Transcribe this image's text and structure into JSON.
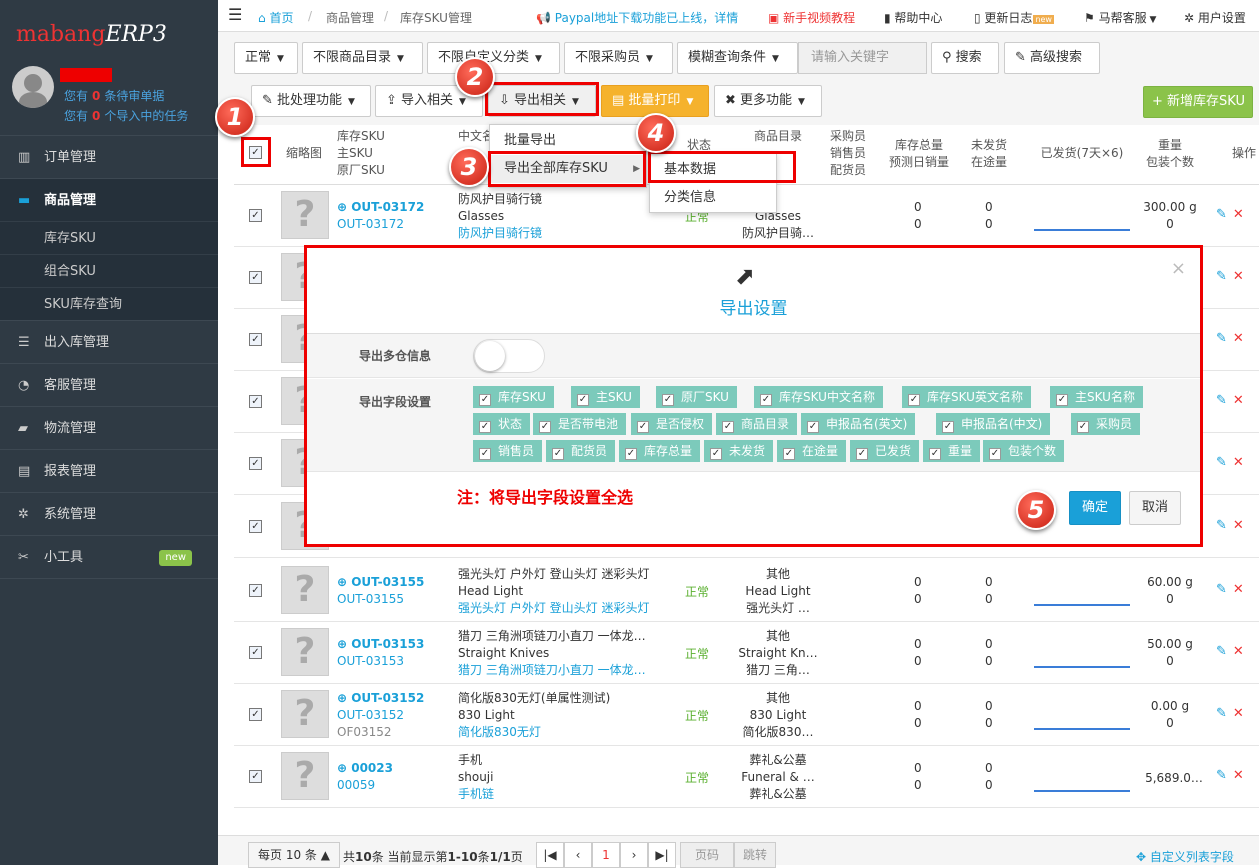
{
  "sidebar": {
    "logo": "mabang",
    "logo_suffix": "ERP3",
    "pending_line_prefix": "您有",
    "pending_count": "0",
    "pending_line_suffix": "条待审单据",
    "import_line_prefix": "您有",
    "import_count": "0",
    "import_line_suffix": "个导入中的任务",
    "menu": [
      {
        "label": "订单管理",
        "icon": "orders-icon"
      },
      {
        "label": "商品管理",
        "icon": "product-icon"
      },
      {
        "label": "出入库管理",
        "icon": "warehouse-icon"
      },
      {
        "label": "客服管理",
        "icon": "chat-icon"
      },
      {
        "label": "物流管理",
        "icon": "truck-icon"
      },
      {
        "label": "报表管理",
        "icon": "report-icon"
      },
      {
        "label": "系统管理",
        "icon": "gear-icon"
      },
      {
        "label": "小工具",
        "icon": "tools-icon",
        "badge": "new"
      }
    ],
    "submenu": [
      "库存SKU",
      "组合SKU",
      "SKU库存查询"
    ]
  },
  "topbar": {
    "home": "首页",
    "crumb1": "商品管理",
    "crumb2": "库存SKU管理",
    "notice": "Paypal地址下载功能已上线，详情",
    "video": "新手视频教程",
    "help": "帮助中心",
    "changelog": "更新日志",
    "changelog_badge": "new",
    "service": "马帮客服",
    "settings": "用户设置"
  },
  "filters": {
    "status": "正常",
    "catalog": "不限商品目录",
    "custom": "不限自定义分类",
    "buyer": "不限采购员",
    "fuzzy": "模糊查询条件",
    "search_placeholder": "请输入关键字",
    "search": "搜索",
    "advanced": "高级搜索"
  },
  "toolbar": {
    "batch": "批处理功能",
    "import": "导入相关",
    "export": "导出相关",
    "print": "批量打印",
    "more": "更多功能",
    "add": "新增库存SKU"
  },
  "table_head": {
    "thumb": "缩略图",
    "sku1": "库存SKU",
    "sku2": "主SKU",
    "sku3": "原厂SKU",
    "name1": "中文名",
    "status": "状态",
    "catalog1": "商品目录",
    "buyer1": "采购员",
    "buyer2": "销售员",
    "buyer3": "配货员",
    "stock1": "库存总量",
    "stock2": "预测日销量",
    "unship1": "未发货",
    "unship2": "在途量",
    "shipped": "已发货(7天×6)",
    "weight1": "重量",
    "weight2": "包装个数",
    "ops": "操作"
  },
  "rows": [
    {
      "sku": "OUT-03172",
      "sku2": "OUT-03172",
      "sku3": "",
      "cn": "防风护目骑行镜",
      "en": "Glasses",
      "cn2": "防风护目骑行镜",
      "status": "正常",
      "cat1": "",
      "cat2": "Glasses",
      "cat3": "防风护目骑…",
      "stock": "0",
      "forecast": "0",
      "unship": "0",
      "transit": "0",
      "weight": "300.00 g",
      "pack": "0",
      "trend": "flat"
    },
    {
      "sku": "OUT-03155",
      "sku2": "OUT-03155",
      "sku3": "",
      "cn": "强光头灯 户外灯 登山头灯 迷彩头灯",
      "en": "Head Light",
      "cn2": "强光头灯 户外灯 登山头灯 迷彩头灯",
      "status": "正常",
      "cat1": "其他",
      "cat2": "Head Light",
      "cat3": "强光头灯 …",
      "stock": "0",
      "forecast": "0",
      "unship": "0",
      "transit": "0",
      "weight": "60.00 g",
      "pack": "0",
      "trend": "flat"
    },
    {
      "sku": "OUT-03153",
      "sku2": "OUT-03153",
      "sku3": "",
      "cn": "猎刀 三角洲项链刀小直刀 一体龙…",
      "en": "Straight Knives",
      "cn2": "猎刀 三角洲项链刀小直刀 一体龙…",
      "status": "正常",
      "cat1": "其他",
      "cat2": "Straight Kn…",
      "cat3": "猎刀 三角…",
      "stock": "0",
      "forecast": "0",
      "unship": "0",
      "transit": "0",
      "weight": "50.00 g",
      "pack": "0",
      "trend": "flat"
    },
    {
      "sku": "OUT-03152",
      "sku2": "OUT-03152",
      "sku3": "OF03152",
      "cn": "简化版830无灯(单属性测试)",
      "en": "830 Light",
      "cn2": "简化版830无灯",
      "status": "正常",
      "cat1": "其他",
      "cat2": "830 Light",
      "cat3": "简化版830…",
      "stock": "0",
      "forecast": "0",
      "unship": "0",
      "transit": "0",
      "weight": "0.00 g",
      "pack": "0",
      "trend": "flat"
    },
    {
      "sku": "00023",
      "sku2": "00059",
      "sku3": "",
      "cn": "手机",
      "en": "shouji",
      "cn2": "手机链",
      "status": "正常",
      "cat1": "葬礼&公墓",
      "cat2": "Funeral & …",
      "cat3": "葬礼&公墓",
      "stock": "0",
      "forecast": "0",
      "unship": "0",
      "transit": "0",
      "weight": "5,689.0…",
      "pack": "0",
      "trend": "flat"
    }
  ],
  "partial_row_text": "…",
  "export_menu": [
    "批量导出",
    "导出全部库存SKU"
  ],
  "export_submenu": [
    "基本数据",
    "分类信息"
  ],
  "modal": {
    "title": "导出设置",
    "close": "×",
    "multi_label": "导出多仓信息",
    "fields_label": "导出字段设置",
    "fields": [
      "库存SKU",
      "主SKU",
      "原厂SKU",
      "库存SKU中文名称",
      "库存SKU英文名称",
      "主SKU名称",
      "状态",
      "是否带电池",
      "是否侵权",
      "商品目录",
      "申报品名(英文)",
      "申报品名(中文)",
      "采购员",
      "销售员",
      "配货员",
      "库存总量",
      "未发货",
      "在途量",
      "已发货",
      "重量",
      "包装个数"
    ],
    "note": "注：将导出字段设置全选",
    "confirm": "确定",
    "cancel": "取消"
  },
  "steps": [
    "1",
    "2",
    "3",
    "4",
    "5"
  ],
  "pager": {
    "per_page": "每页 10 条",
    "summary_a": "共",
    "total": "10",
    "summary_b": "条 当前显示第",
    "range": "1-10",
    "summary_c": "条",
    "pages": "1/1",
    "summary_d": "页",
    "current": "1",
    "page_input": "页码",
    "jump": "跳转",
    "custom_cols": "自定义列表字段"
  },
  "colors": {
    "accent": "#1aa0d8",
    "danger": "#e00000",
    "green": "#5cb85c",
    "tag": "#7ccabb",
    "print": "#f0ad4e"
  }
}
